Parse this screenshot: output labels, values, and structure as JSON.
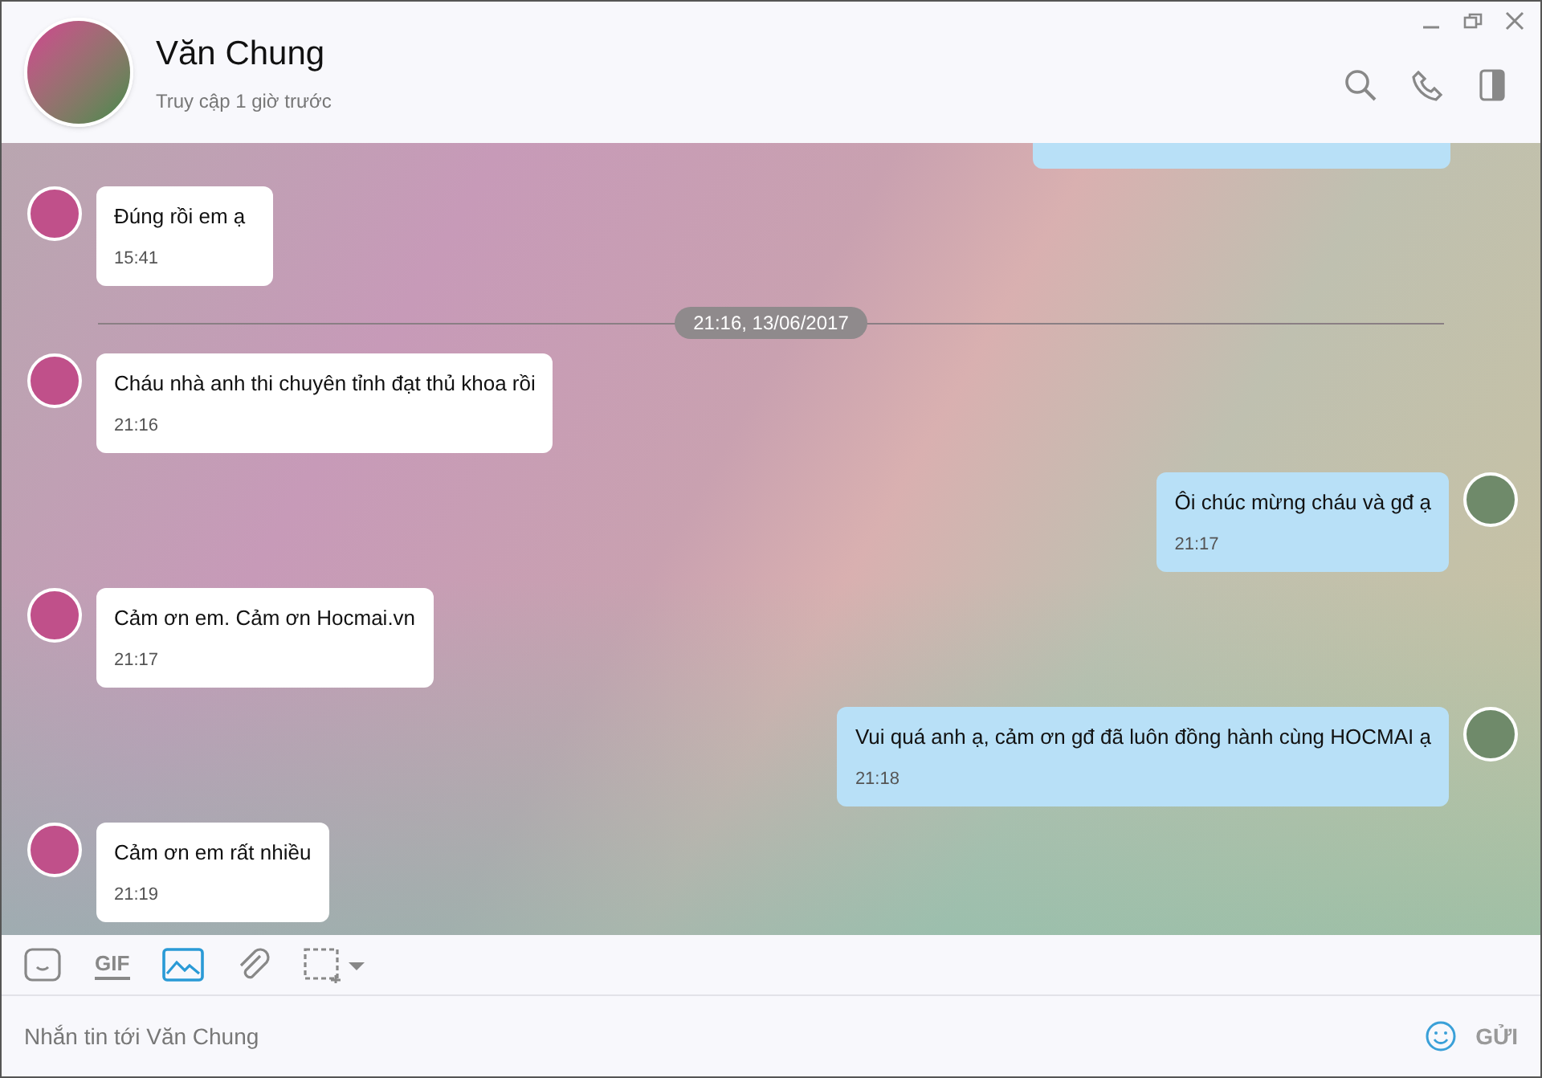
{
  "header": {
    "name": "Văn Chung",
    "status": "Truy cập 1 giờ trước"
  },
  "messages": [
    {
      "kind": "clipped"
    },
    {
      "kind": "incoming",
      "text": "Đúng rồi em ạ",
      "time": "15:41"
    },
    {
      "kind": "divider",
      "text": "21:16, 13/06/2017"
    },
    {
      "kind": "incoming",
      "text": "Cháu nhà anh thi chuyên tỉnh đạt thủ khoa rồi",
      "time": "21:16"
    },
    {
      "kind": "outgoing",
      "text": "Ôi chúc mừng cháu và gđ ạ",
      "time": "21:17"
    },
    {
      "kind": "incoming",
      "text": "Cảm ơn em. Cảm ơn Hocmai.vn",
      "time": "21:17"
    },
    {
      "kind": "outgoing",
      "text": "Vui quá anh ạ, cảm ơn gđ đã luôn đồng hành cùng HOCMAI ạ",
      "time": "21:18"
    },
    {
      "kind": "incoming",
      "text": "Cảm ơn em rất nhiều",
      "time": "21:19"
    }
  ],
  "toolbar": {
    "gif_label": "GIF",
    "image_selected": true
  },
  "composer": {
    "placeholder": "Nhắn tin tới Văn Chung",
    "send": "GỬI"
  }
}
